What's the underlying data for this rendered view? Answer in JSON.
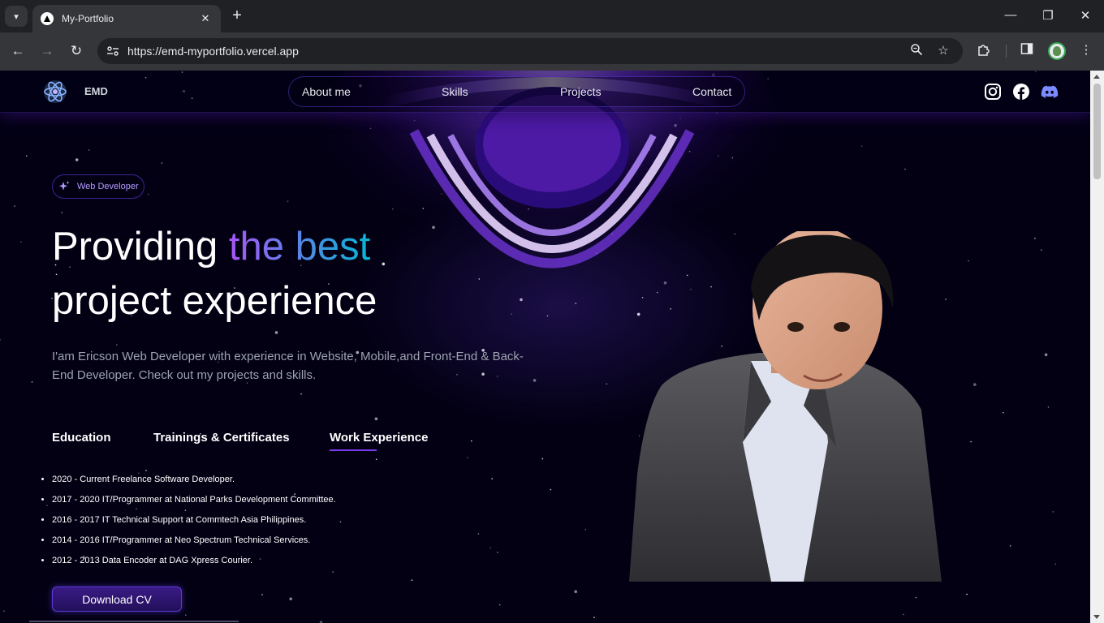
{
  "browser": {
    "tab_title": "My-Portfolio",
    "url": "https://emd-myportfolio.vercel.app",
    "icons": [
      "tab-search-icon",
      "close-icon",
      "new-tab-icon",
      "minimize-icon",
      "restore-icon",
      "close-window-icon",
      "back-icon",
      "forward-icon",
      "reload-icon",
      "site-info-icon",
      "zoom-icon",
      "bookmark-star-icon",
      "extensions-icon",
      "side-panel-icon",
      "profile-avatar",
      "menu-icon"
    ]
  },
  "header": {
    "brand": "EMD",
    "nav": [
      "About me",
      "Skills",
      "Projects",
      "Contact"
    ],
    "social_icons": [
      "instagram-icon",
      "facebook-icon",
      "discord-icon"
    ]
  },
  "hero": {
    "badge": "Web Developer",
    "heading_line1_plain": "Providing ",
    "heading_line1_accent": "the best",
    "heading_line2": "project experience",
    "description": "I'am Ericson Web Developer with experience in Website, Mobile,and Front-End & Back-End Developer. Check out my projects and skills.",
    "tabs": [
      "Education",
      "Trainings & Certificates",
      "Work Experience"
    ],
    "active_tab": "Work Experience",
    "work_experience": [
      "2020 - Current Freelance Software Developer.",
      "2017 - 2020  IT/Programmer at National Parks Development Committee.",
      "2016 - 2017  IT Technical Support at Commtech Asia Philippines.",
      "2014 - 2016   IT/Programmer at Neo Spectrum Technical Services.",
      "2012 - 2013   Data Encoder at DAG Xpress Courier."
    ],
    "cta": "Download CV"
  },
  "colors": {
    "page_bg": "#030014",
    "accent_purple": "#7042f8",
    "gradient_start": "#a855f7",
    "gradient_end": "#06b6d4"
  }
}
